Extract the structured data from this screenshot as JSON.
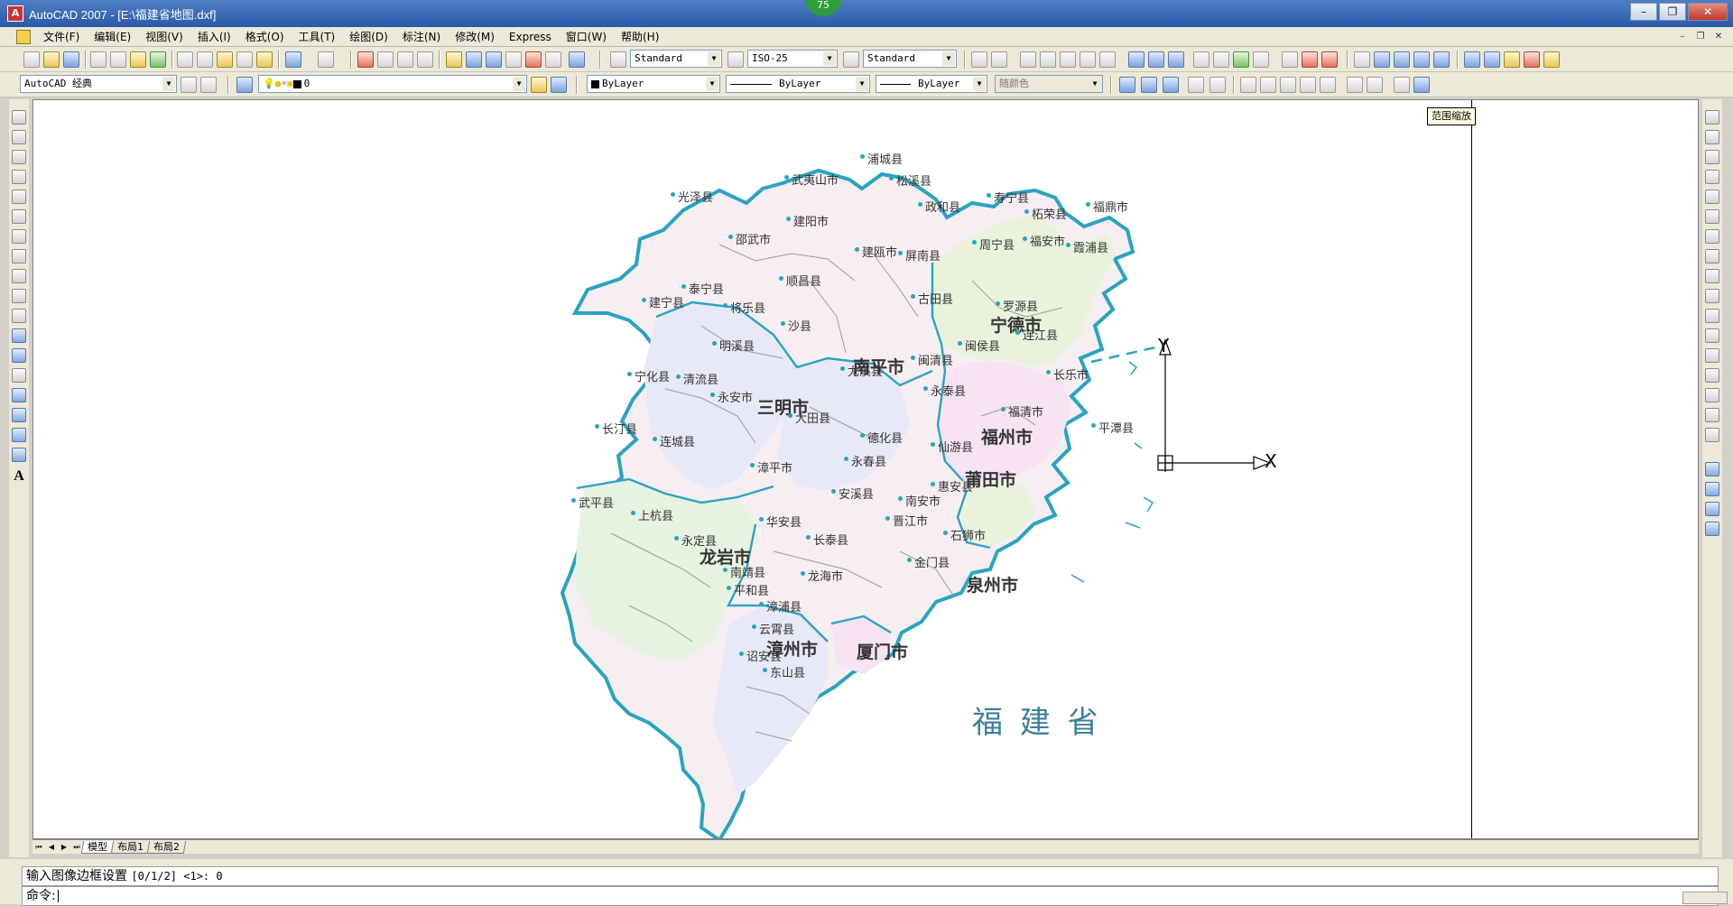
{
  "window": {
    "title": "AutoCAD 2007 - [E:\\福建省地图.dxf]",
    "app_icon": "autocad-icon",
    "badge": "75",
    "buttons": [
      "minimize",
      "restore",
      "close"
    ]
  },
  "menubar": {
    "items": [
      "文件(F)",
      "编辑(E)",
      "视图(V)",
      "插入(I)",
      "格式(O)",
      "工具(T)",
      "绘图(D)",
      "标注(N)",
      "修改(M)",
      "Express",
      "窗口(W)",
      "帮助(H)"
    ]
  },
  "styles_toolbar": {
    "text_style": "Standard",
    "dim_style": "ISO-25",
    "table_style": "Standard"
  },
  "properties_toolbar": {
    "workspace": "AutoCAD 经典",
    "layer": "0",
    "color": "ByLayer",
    "linetype": "ByLayer",
    "lineweight": "ByLayer",
    "plot_style": "随颜色"
  },
  "tooltip": "范围缩放",
  "map": {
    "province_label": "福 建 省",
    "cities": [
      {
        "name": "南平市"
      },
      {
        "name": "宁德市"
      },
      {
        "name": "三明市"
      },
      {
        "name": "福州市"
      },
      {
        "name": "莆田市"
      },
      {
        "name": "龙岩市"
      },
      {
        "name": "泉州市"
      },
      {
        "name": "漳州市"
      },
      {
        "name": "厦门市"
      }
    ],
    "counties": [
      "浦城县",
      "武夷山市",
      "松溪县",
      "光泽县",
      "政和县",
      "寿宁县",
      "柘荣县",
      "福鼎市",
      "建阳市",
      "邵武市",
      "建瓯市",
      "屏南县",
      "周宁县",
      "福安市",
      "霞浦县",
      "泰宁县",
      "建宁县",
      "将乐县",
      "顺昌县",
      "古田县",
      "罗源县",
      "沙县",
      "明溪县",
      "连江县",
      "闽清县",
      "闽侯县",
      "宁化县",
      "清流县",
      "尤溪县",
      "长乐市",
      "永安市",
      "永泰县",
      "大田县",
      "福清市",
      "平潭县",
      "长汀县",
      "连城县",
      "德化县",
      "仙游县",
      "漳平市",
      "永春县",
      "惠安县",
      "武平县",
      "上杭县",
      "安溪县",
      "南安市",
      "晋江市",
      "石狮市",
      "华安县",
      "长泰县",
      "永定县",
      "金门县",
      "南靖县",
      "龙海市",
      "平和县",
      "漳浦县",
      "云霄县",
      "诏安县",
      "东山县"
    ]
  },
  "ucs": {
    "x_label": "X",
    "y_label": "Y"
  },
  "layout_tabs": [
    "模型",
    "布局1",
    "布局2"
  ],
  "command": {
    "history": "输入图像边框设置",
    "history_options": "[0/1/2] <1>:  0",
    "prompt": "命令:"
  }
}
